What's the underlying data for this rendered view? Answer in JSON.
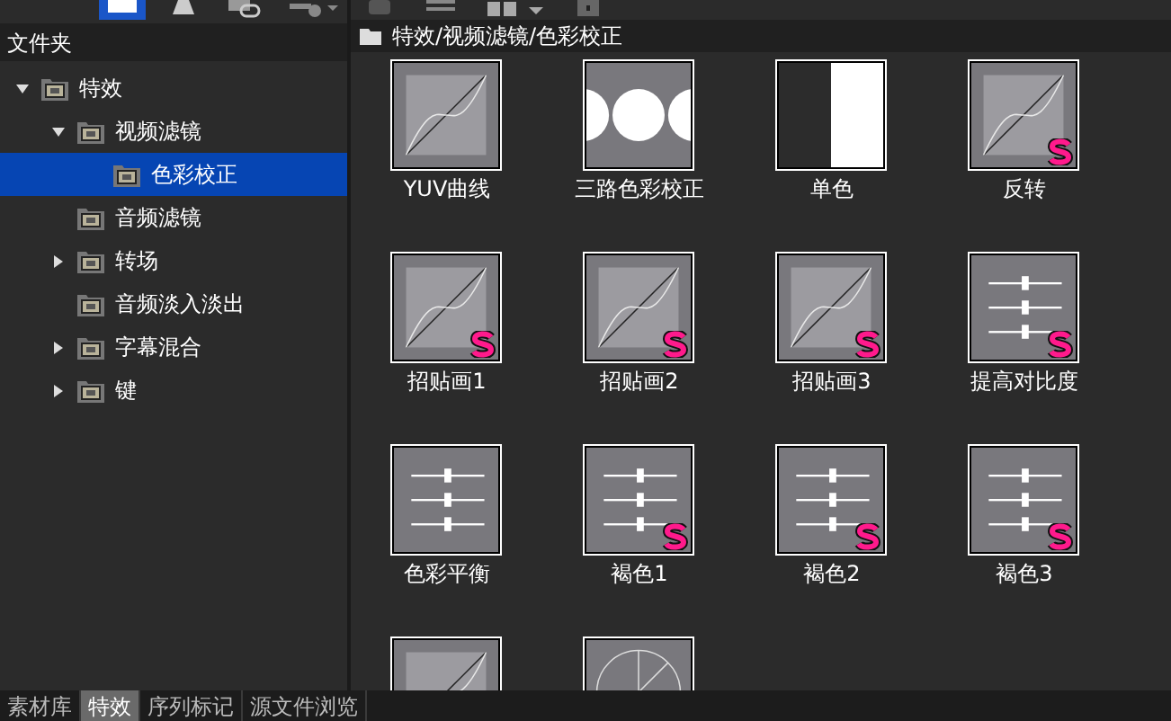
{
  "left_panel": {
    "title": "文件夹",
    "tree": [
      {
        "label": "特效",
        "expanded": true,
        "selected": false,
        "children": [
          {
            "label": "视频滤镜",
            "expanded": true,
            "selected": false,
            "children": [
              {
                "label": "色彩校正",
                "selected": true
              }
            ]
          },
          {
            "label": "音频滤镜",
            "selected": false
          },
          {
            "label": "转场",
            "expanded": false,
            "selected": false
          },
          {
            "label": "音频淡入淡出",
            "selected": false
          },
          {
            "label": "字幕混合",
            "expanded": false,
            "selected": false
          },
          {
            "label": "键",
            "expanded": false,
            "selected": false
          }
        ]
      }
    ]
  },
  "right_panel": {
    "path": "特效/视频滤镜/色彩校正",
    "effects": [
      {
        "label": "YUV曲线",
        "kind": "curve",
        "s_badge": false
      },
      {
        "label": "三路色彩校正",
        "kind": "circles",
        "s_badge": false
      },
      {
        "label": "单色",
        "kind": "mono",
        "s_badge": false
      },
      {
        "label": "反转",
        "kind": "curve",
        "s_badge": true
      },
      {
        "label": "招贴画1",
        "kind": "curve",
        "s_badge": true
      },
      {
        "label": "招贴画2",
        "kind": "curve",
        "s_badge": true
      },
      {
        "label": "招贴画3",
        "kind": "curve",
        "s_badge": true
      },
      {
        "label": "提高对比度",
        "kind": "sliders",
        "s_badge": true
      },
      {
        "label": "色彩平衡",
        "kind": "sliders",
        "s_badge": false
      },
      {
        "label": "褐色1",
        "kind": "sliders",
        "s_badge": true
      },
      {
        "label": "褐色2",
        "kind": "sliders",
        "s_badge": true
      },
      {
        "label": "褐色3",
        "kind": "sliders",
        "s_badge": true
      },
      {
        "kind": "curve",
        "s_badge": false
      },
      {
        "kind": "wheel",
        "s_badge": false
      }
    ]
  },
  "bottom_tabs": [
    {
      "label": "素材库",
      "selected": false
    },
    {
      "label": "特效",
      "selected": true
    },
    {
      "label": "序列标记",
      "selected": false
    },
    {
      "label": "源文件浏览",
      "selected": false
    }
  ]
}
